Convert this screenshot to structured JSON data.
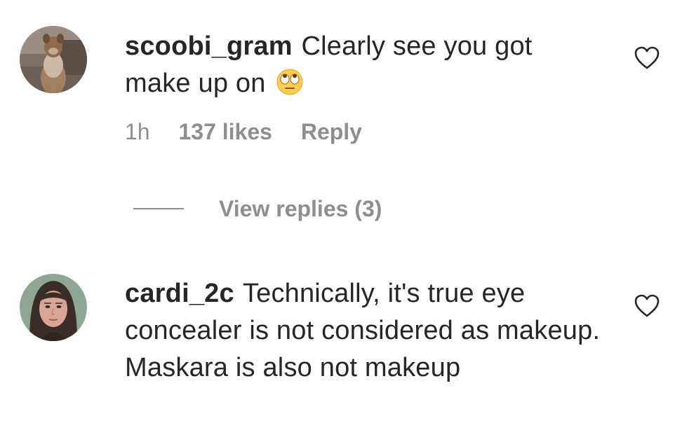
{
  "comments": [
    {
      "username": "scoobi_gram",
      "text": "Clearly see you got make up on",
      "emoji": "face-with-rolling-eyes",
      "time": "1h",
      "likes": "137 likes",
      "reply_label": "Reply",
      "view_replies": "View replies (3)"
    },
    {
      "username": "cardi_2c",
      "text": "Technically, it's true eye concealer is not considered as makeup. Maskara is also not makeup"
    }
  ],
  "icons": {
    "like": "heart-outline-icon"
  },
  "colors": {
    "text": "#262626",
    "muted": "#8e8e8e",
    "background": "#ffffff"
  }
}
